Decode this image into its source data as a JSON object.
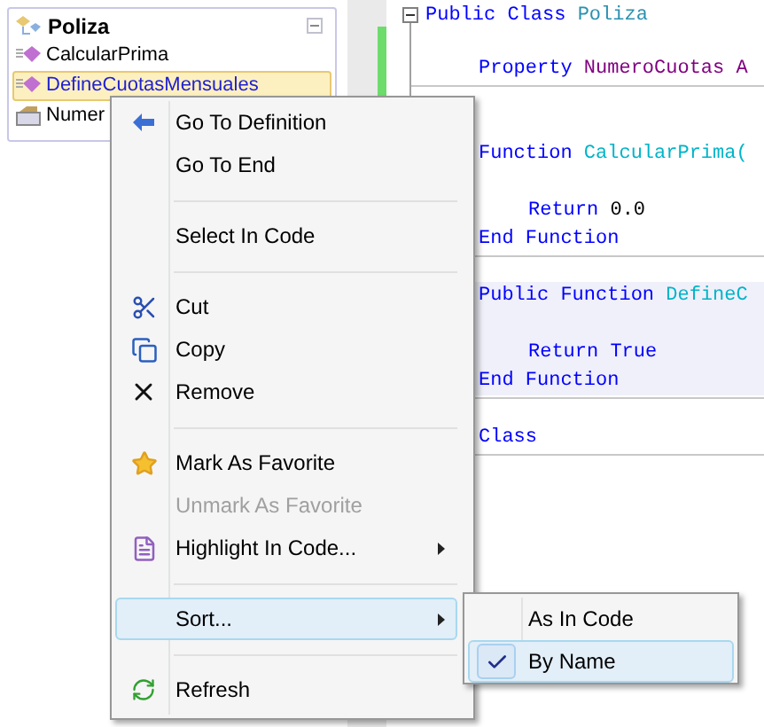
{
  "class_view": {
    "root": {
      "label": "Poliza",
      "expanded": true,
      "children": [
        {
          "label": "CalcularPrima",
          "kind": "method",
          "selected": false
        },
        {
          "label": "DefineCuotasMensuales",
          "kind": "method",
          "selected": true
        },
        {
          "label": "Numer",
          "kind": "property",
          "selected": false
        }
      ]
    }
  },
  "editor": {
    "header": {
      "tokens": [
        {
          "text": "Public Class ",
          "kind": "keyword"
        },
        {
          "text": "Poliza",
          "kind": "type"
        }
      ]
    },
    "members": [
      {
        "highlighted": false,
        "lines": [
          {
            "tokens": [
              {
                "text": "Property ",
                "kind": "keyword"
              },
              {
                "text": "NumeroCuotas A",
                "kind": "property"
              }
            ]
          }
        ]
      },
      {
        "highlighted": false,
        "lines": [
          {
            "tokens": [
              {
                "text": "Function ",
                "kind": "keyword"
              },
              {
                "text": "CalcularPrima(",
                "kind": "method"
              }
            ],
            "children": [
              {
                "tokens": [
                  {
                    "text": "Return ",
                    "kind": "keyword"
                  },
                  {
                    "text": "0.0",
                    "kind": "plain"
                  }
                ]
              }
            ]
          },
          {
            "tokens": [
              {
                "text": "End Function",
                "kind": "keyword"
              }
            ]
          }
        ]
      },
      {
        "highlighted": true,
        "lines": [
          {
            "tokens": [
              {
                "text": "Public Function ",
                "kind": "keyword"
              },
              {
                "text": "DefineC",
                "kind": "method"
              }
            ],
            "children": [
              {
                "tokens": [
                  {
                    "text": "Return True",
                    "kind": "keyword"
                  }
                ]
              }
            ]
          },
          {
            "tokens": [
              {
                "text": "End Function",
                "kind": "keyword"
              }
            ]
          }
        ]
      }
    ],
    "footer": {
      "tokens": [
        {
          "text": "Class",
          "kind": "keyword"
        }
      ]
    }
  },
  "context_menu": {
    "items": [
      {
        "kind": "item",
        "label": "Go To Definition",
        "disabled": false,
        "selected": false,
        "submenu": false
      },
      {
        "kind": "item",
        "label": "Go To End",
        "disabled": false,
        "selected": false,
        "submenu": false
      },
      {
        "kind": "separator"
      },
      {
        "kind": "item",
        "label": "Select In Code",
        "disabled": false,
        "selected": false,
        "submenu": false
      },
      {
        "kind": "separator"
      },
      {
        "kind": "item",
        "label": "Cut",
        "disabled": false,
        "selected": false,
        "submenu": false
      },
      {
        "kind": "item",
        "label": "Copy",
        "disabled": false,
        "selected": false,
        "submenu": false
      },
      {
        "kind": "item",
        "label": "Remove",
        "disabled": false,
        "selected": false,
        "submenu": false
      },
      {
        "kind": "separator"
      },
      {
        "kind": "item",
        "label": "Mark As Favorite",
        "disabled": false,
        "selected": false,
        "submenu": false
      },
      {
        "kind": "item",
        "label": "Unmark As Favorite",
        "disabled": true,
        "selected": false,
        "submenu": false
      },
      {
        "kind": "item",
        "label": "Highlight In Code...",
        "disabled": false,
        "selected": false,
        "submenu": true
      },
      {
        "kind": "separator"
      },
      {
        "kind": "item",
        "label": "Sort...",
        "disabled": false,
        "selected": true,
        "submenu": true
      },
      {
        "kind": "separator"
      },
      {
        "kind": "item",
        "label": "Refresh",
        "disabled": false,
        "selected": false,
        "submenu": false
      }
    ]
  },
  "submenu": {
    "items": [
      {
        "label": "As In Code",
        "checked": false,
        "selected": false
      },
      {
        "label": "By Name",
        "checked": true,
        "selected": true
      }
    ]
  }
}
